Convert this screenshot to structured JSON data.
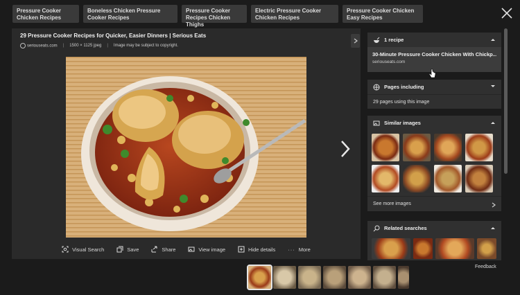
{
  "related_chips": [
    "Pressure Cooker Chicken Recipes",
    "Boneless Chicken Pressure Cooker Recipes",
    "Pressure Cooker Recipes Chicken Thighs",
    "Electric Pressure Cooker Chicken Recipes",
    "Pressure Cooker Chicken Easy Recipes"
  ],
  "image": {
    "title": "29 Pressure Cooker Recipes for Quicker, Easier Dinners | Serious Eats",
    "source": "seriouseats.com",
    "dimensions": "1500 × 1125 jpeg",
    "copyright": "Image may be subject to copyright."
  },
  "actions": {
    "visual_search": "Visual Search",
    "save": "Save",
    "share": "Share",
    "view_image": "View image",
    "hide_details": "Hide details",
    "more": "More"
  },
  "panel": {
    "recipes": {
      "header": "1 recipe",
      "item_title": "30-Minute Pressure Cooker Chicken With Chickp...",
      "item_source": "seriouseats.com"
    },
    "pages": {
      "header": "Pages including",
      "row": "29 pages using this image"
    },
    "similar": {
      "header": "Similar images",
      "see_more": "See more images"
    },
    "related": {
      "header": "Related searches"
    }
  },
  "feedback": "Feedback",
  "colors": {
    "background": "#1b1b1b",
    "panel": "#303030",
    "chip": "#3a3a3a"
  }
}
